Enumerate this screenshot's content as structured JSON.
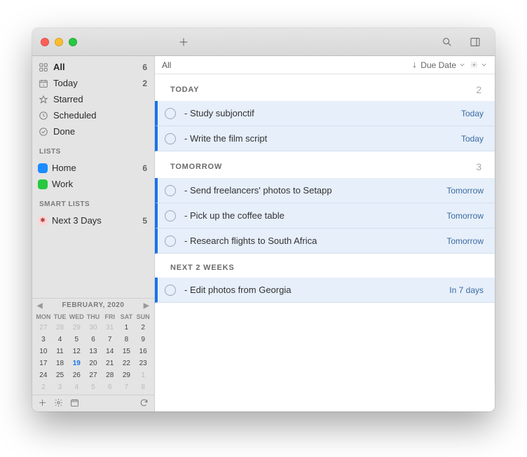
{
  "sidebar": {
    "items": [
      {
        "label": "All",
        "count": "6",
        "icon": "grid"
      },
      {
        "label": "Today",
        "count": "2",
        "icon": "calendar-day"
      },
      {
        "label": "Starred",
        "count": "",
        "icon": "star"
      },
      {
        "label": "Scheduled",
        "count": "",
        "icon": "clock"
      },
      {
        "label": "Done",
        "count": "",
        "icon": "check"
      }
    ],
    "lists_header": "LISTS",
    "lists": [
      {
        "label": "Home",
        "count": "6",
        "color": "#1a8cff"
      },
      {
        "label": "Work",
        "count": "",
        "color": "#28c840"
      }
    ],
    "smart_header": "SMART LISTS",
    "smart": [
      {
        "label": "Next 3 Days",
        "count": "5"
      }
    ]
  },
  "calendar": {
    "title": "FEBRUARY, 2020",
    "dow": [
      "MON",
      "TUE",
      "WED",
      "THU",
      "FRI",
      "SAT",
      "SUN"
    ],
    "today": 19,
    "leading_out": [
      27,
      28,
      29,
      30,
      31
    ],
    "days": [
      1,
      2,
      3,
      4,
      5,
      6,
      7,
      8,
      9,
      10,
      11,
      12,
      13,
      14,
      15,
      16,
      17,
      18,
      19,
      20,
      21,
      22,
      23,
      24,
      25,
      26,
      27,
      28,
      29
    ],
    "trailing_out": [
      1,
      2,
      3,
      4,
      5,
      6,
      7,
      8
    ]
  },
  "filterbar": {
    "scope": "All",
    "sort_label": "Due Date"
  },
  "sections": [
    {
      "title": "TODAY",
      "count": "2",
      "tasks": [
        {
          "title": "- Study subjonctif",
          "due": "Today"
        },
        {
          "title": "- Write the film script",
          "due": "Today"
        }
      ]
    },
    {
      "title": "TOMORROW",
      "count": "3",
      "tasks": [
        {
          "title": "- Send freelancers' photos to Setapp",
          "due": "Tomorrow"
        },
        {
          "title": "- Pick up the coffee table",
          "due": "Tomorrow"
        },
        {
          "title": "- Research flights to South Africa",
          "due": "Tomorrow"
        }
      ]
    },
    {
      "title": "NEXT 2 WEEKS",
      "count": "",
      "tasks": [
        {
          "title": "- Edit photos from Georgia",
          "due": "In 7 days"
        }
      ]
    }
  ]
}
